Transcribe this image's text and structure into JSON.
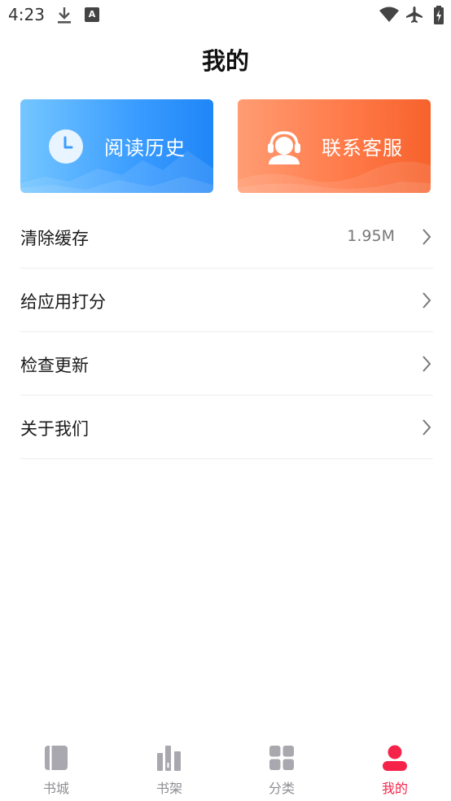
{
  "status_bar": {
    "time": "4:23",
    "icons": [
      "download-icon",
      "text-a-icon",
      "wifi-icon",
      "airplane-icon",
      "battery-charging-icon"
    ]
  },
  "header": {
    "title": "我的"
  },
  "cards": [
    {
      "id": "history",
      "label": "阅读历史",
      "icon": "clock-icon",
      "color": "#3a9cff"
    },
    {
      "id": "service",
      "label": "联系客服",
      "icon": "headset-agent-icon",
      "color": "#ff7b4a"
    }
  ],
  "settings": [
    {
      "label": "清除缓存",
      "value": "1.95M"
    },
    {
      "label": "给应用打分",
      "value": ""
    },
    {
      "label": "检查更新",
      "value": ""
    },
    {
      "label": "关于我们",
      "value": ""
    }
  ],
  "bottom_nav": {
    "active_color": "#f5234a",
    "inactive_color": "#8e8e93",
    "items": [
      {
        "label": "书城",
        "icon": "book-icon",
        "active": false
      },
      {
        "label": "书架",
        "icon": "bookshelf-icon",
        "active": false
      },
      {
        "label": "分类",
        "icon": "grid-icon",
        "active": false
      },
      {
        "label": "我的",
        "icon": "profile-icon",
        "active": true
      }
    ]
  }
}
